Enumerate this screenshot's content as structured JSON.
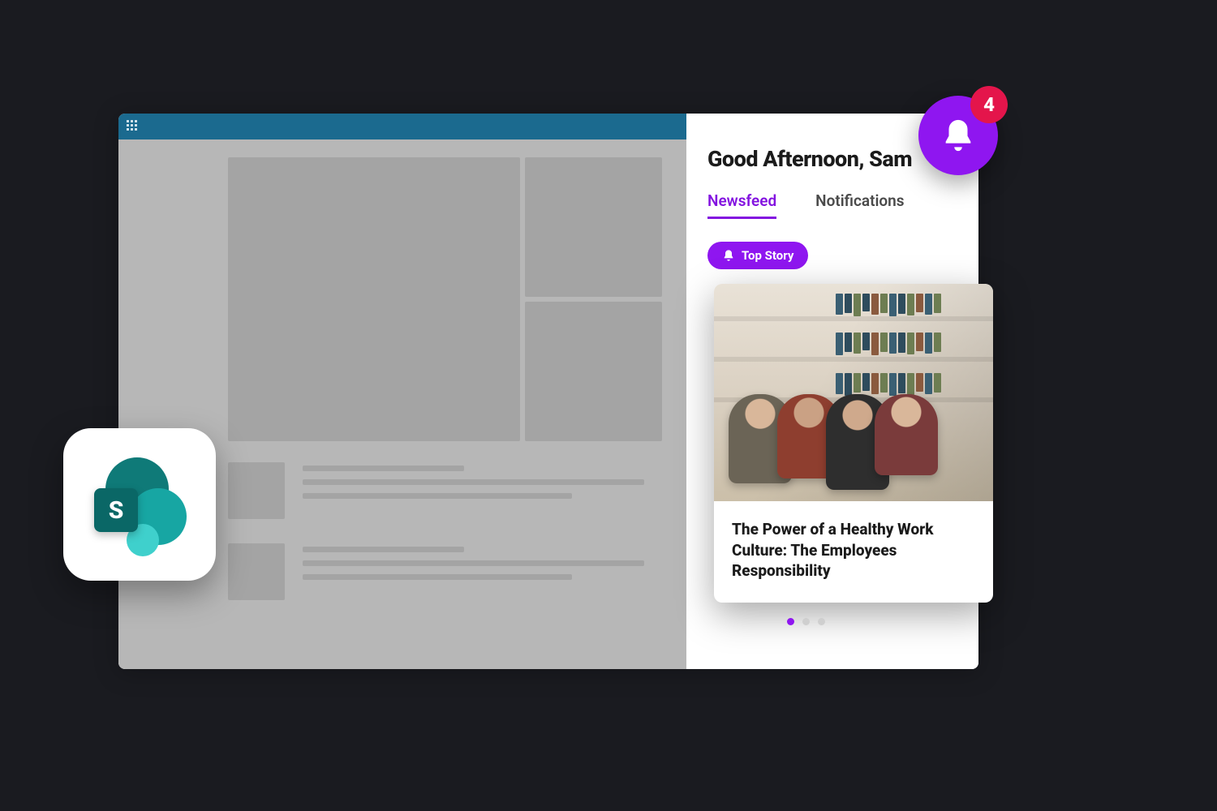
{
  "notifications": {
    "badge_count": "4"
  },
  "sidebar": {
    "greeting": "Good Afternoon, Sam",
    "tabs": {
      "newsfeed": "Newsfeed",
      "notifications": "Notifications"
    },
    "top_story_label": "Top Story",
    "story": {
      "title": "The Power of a Healthy Work Culture: The Employees Responsibility"
    },
    "pager": {
      "active_index": 0,
      "count": 3
    }
  },
  "app_chip": {
    "letter": "S",
    "name": "sharepoint"
  }
}
